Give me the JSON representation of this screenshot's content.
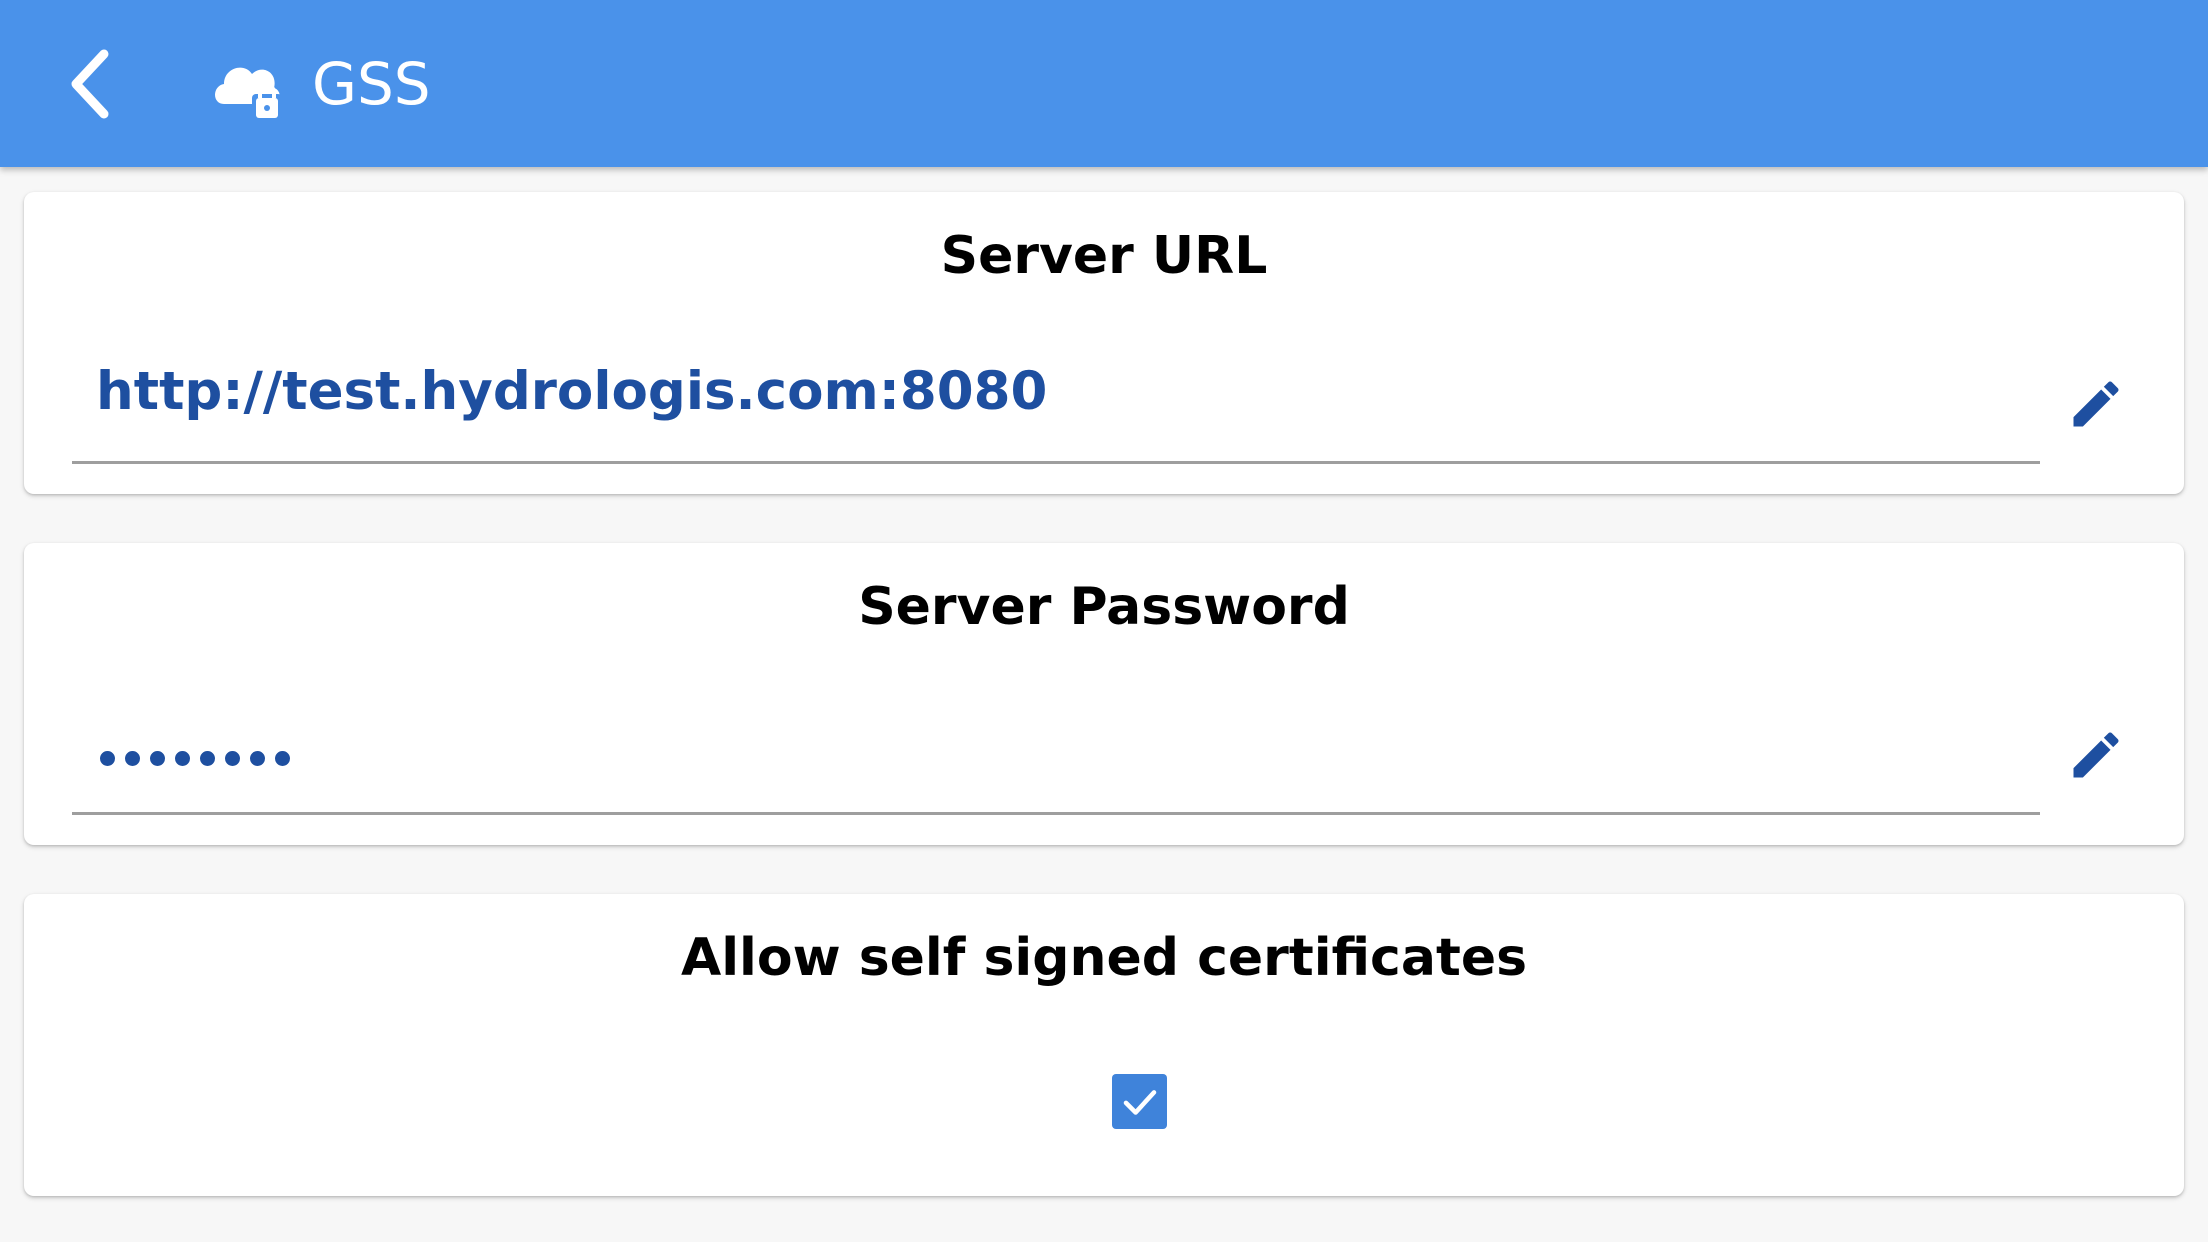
{
  "colors": {
    "accent": "#4a92ea",
    "value_text": "#1e4fa0",
    "checkbox": "#3f83da"
  },
  "appbar": {
    "title": "GSS",
    "back_icon": "chevron-left-icon",
    "title_icon": "cloud-lock-icon"
  },
  "server_url": {
    "title": "Server URL",
    "value": "http://test.hydrologis.com:8080",
    "edit_icon": "pencil-icon"
  },
  "server_password": {
    "title": "Server Password",
    "masked_length": 8,
    "edit_icon": "pencil-icon"
  },
  "self_signed": {
    "title": "Allow self signed certificates",
    "checked": true
  }
}
